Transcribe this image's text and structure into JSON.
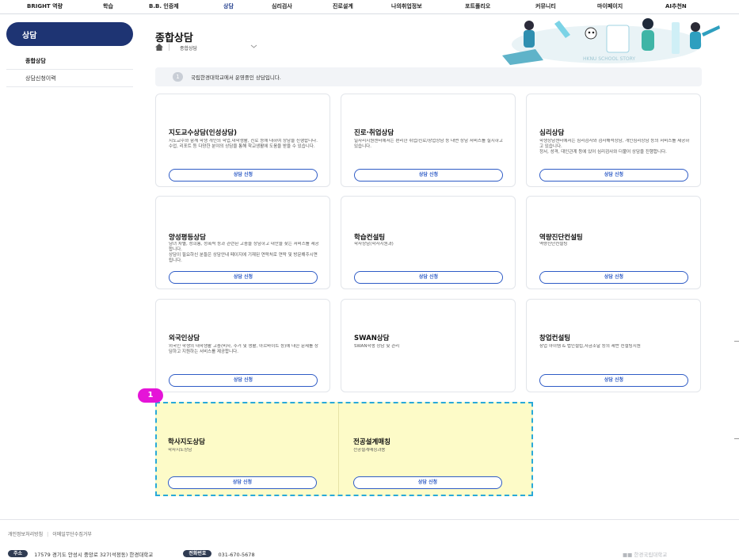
{
  "nav": {
    "items": [
      "BRIGHT 역량",
      "학습",
      "B.B. 인증제",
      "상담",
      "심리검사",
      "진로설계",
      "나의취업정보",
      "포트폴리오",
      "커뮤니티",
      "마이페이지",
      "AI추천N"
    ],
    "active_index": 3
  },
  "sidebar": {
    "title": "상담",
    "items": [
      "종합상담",
      "상담신청이력"
    ]
  },
  "header": {
    "title": "종합상담",
    "breadcrumb": "종합상담"
  },
  "hero": {
    "caption": "HKNU SCHOOL STORY"
  },
  "notice": {
    "number": "1",
    "text": "국립한경대학교에서 운영중인 상담입니다."
  },
  "cards": [
    {
      "title": "지도교수상담(인성상담)",
      "desc": "지도교수와 함께 학생 개인의 학업,대학생활, 진로 등에 대하여 상담을 진행합니다.\n수업, 리포트 등 다양한 분야의 상담을 통해 학교생활에 도움을 받을 수 있습니다.",
      "button": "상담 신청"
    },
    {
      "title": "진로·취업상담",
      "desc": "일자리지원센터에서는 편리한 취업/진로/창업상담 등 대면 상담 서비스를 실시하고 있습니다.",
      "button": "상담 신청"
    },
    {
      "title": "심리상담",
      "desc": "학생상담센터에서는 심리검사와 검사해석상담, 개인심리상담 등의 서비스를 제공하고 있습니다.\n정서, 성격, 대인관계 등에 있어 심리검사와 더불어 상담을 진행합니다.",
      "button": "상담 신청"
    },
    {
      "title": "양성평등상담",
      "desc": "남녀 차별, 성희롱, 성폭력 등과 관련된 고충을 상담하고 대안을 찾는 서비스를 제공합니다.\n상담이 필요하신 분들은 상담안내 페이지에 기재된 연락처로 연락 및 방문해주시면 됩니다.",
      "button": "상담 신청"
    },
    {
      "title": "학습컨설팅",
      "desc": "학사상담(학사지원과)",
      "button": "상담 신청"
    },
    {
      "title": "역량진단컨설팅",
      "desc": "역량진단컨설팅",
      "button": "상담 신청"
    },
    {
      "title": "외국인상담",
      "desc": "외국인 학생의 대학생활 고충(비자, 주거 및 생활, 아르바이트 등)에 대한 문제를 상담하고 지원하는 서비스를 제공합니다.",
      "button": "상담 신청"
    },
    {
      "title": "SWAN상담",
      "desc": "SWAN학생 상담 및 관리",
      "button": ""
    },
    {
      "title": "창업컨설팅",
      "desc": "창업 아이템 & 법인설립,자금조달 등의 제반 컨설팅지원",
      "button": "상담 신청"
    },
    {
      "title": "학사지도상담",
      "desc": "학사지도상담",
      "button": "상담 신청"
    },
    {
      "title": "전공설계매칭",
      "desc": "전공설계매칭과용",
      "button": "상담 신청"
    }
  ],
  "annotation": {
    "marker": "1"
  },
  "footer": {
    "links": [
      "개인정보처리방침",
      "이메일무단수집거부"
    ],
    "address_tag": "주소",
    "address": "17579 경기도 안성시 중앙로 327(석정동) 한경대학교",
    "phone_tag": "전화번호",
    "phone": "031-670-5678",
    "logo": "한경국립대학교"
  },
  "colors": {
    "primary": "#1e3473",
    "accent": "#2f5cc6",
    "highlight": "#fdfbc8",
    "highlight_border": "#29a9d8",
    "marker": "#e514d8"
  }
}
